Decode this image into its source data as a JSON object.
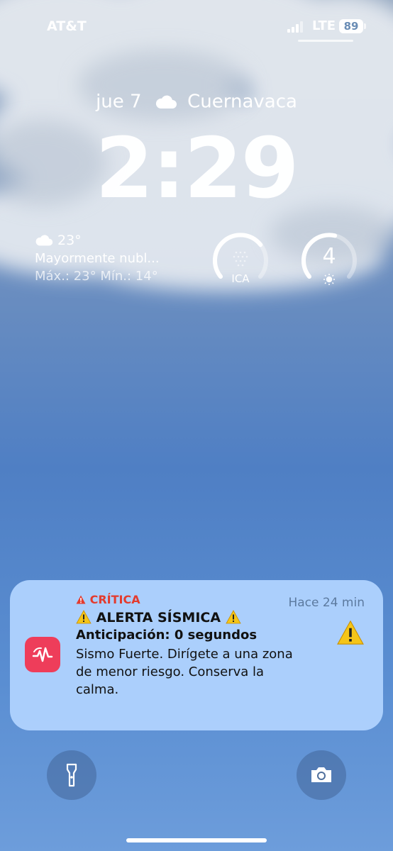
{
  "status_bar": {
    "carrier": "AT&T",
    "network": "LTE",
    "battery": "89"
  },
  "lock_screen": {
    "date": "jue 7",
    "city": "Cuernavaca",
    "time": "2:29",
    "icons": {
      "weather": "cloud-icon",
      "signal": "signal-bars-icon"
    }
  },
  "weather_widget": {
    "temperature": "23°",
    "condition": "Mayormente nubl...",
    "high_low": "Máx.: 23° Mín.: 14°"
  },
  "aqi_widget": {
    "label": "ICA",
    "level": 0.7
  },
  "uv_widget": {
    "value": "4",
    "level": 0.55
  },
  "notification": {
    "level": "CRÍTICA",
    "title": "ALERTA SÍSMICA",
    "subtitle": "Anticipación: 0 segundos",
    "body": "Sismo Fuerte. Dirígete a una zona de menor riesgo. Conserva la calma.",
    "time": "Hace 24 min",
    "colors": {
      "critical": "#e33b2e",
      "app_icon": "#ee3d5a",
      "warning": "#f5c518"
    }
  },
  "quick_actions": {
    "left": "flashlight-icon",
    "right": "camera-icon"
  }
}
